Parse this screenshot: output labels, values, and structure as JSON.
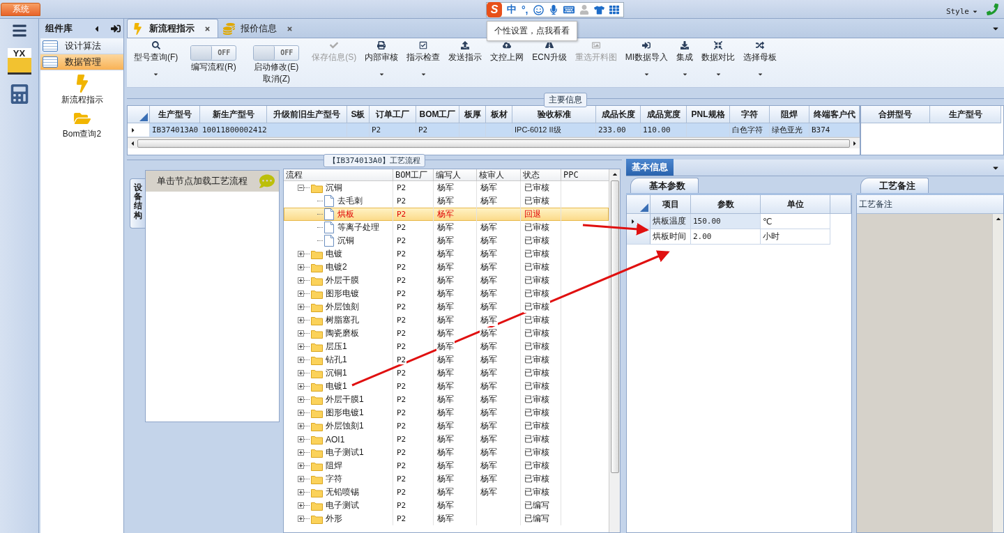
{
  "top_bar": {
    "system_button": "系统",
    "style_menu": "Style"
  },
  "ime_toolbar": {
    "logo": "S",
    "mode": "中",
    "punctuation": "°,",
    "tooltip": "个性设置，点我看看"
  },
  "rail": {
    "logo": "YX"
  },
  "component_panel": {
    "title": "组件库",
    "items": [
      {
        "label": "设计算法",
        "selected": false
      },
      {
        "label": "数据管理",
        "selected": true
      }
    ],
    "shortcuts": [
      "新流程指示",
      "Bom查询2"
    ]
  },
  "tabs": [
    {
      "label": "新流程指示",
      "selected": true
    },
    {
      "label": "报价信息",
      "selected": false
    }
  ],
  "toolbar": [
    {
      "kind": "button",
      "label": "型号查询(F)",
      "disabled": false,
      "dropdown": true
    },
    {
      "kind": "toggle",
      "switch": "OFF",
      "on": false,
      "label": "编写流程(R)"
    },
    {
      "kind": "toggle",
      "switch": "OFF",
      "on": false,
      "label": "启动修改(E)",
      "sublabel": "取消(Z)"
    },
    {
      "kind": "button",
      "label": "保存信息(S)",
      "disabled": true,
      "dropdown": false
    },
    {
      "kind": "button",
      "label": "内部审核",
      "disabled": false,
      "dropdown": true
    },
    {
      "kind": "button",
      "label": "指示检查",
      "disabled": false,
      "dropdown": true
    },
    {
      "kind": "button",
      "label": "发送指示",
      "disabled": false,
      "dropdown": false
    },
    {
      "kind": "button",
      "label": "文控上网",
      "disabled": false,
      "dropdown": false
    },
    {
      "kind": "button",
      "label": "ECN升级",
      "disabled": false,
      "dropdown": false
    },
    {
      "kind": "button",
      "label": "重选开料图",
      "disabled": true,
      "dropdown": false
    },
    {
      "kind": "button",
      "label": "MI数据导入",
      "disabled": false,
      "dropdown": true
    },
    {
      "kind": "button",
      "label": "集成",
      "disabled": false,
      "dropdown": true
    },
    {
      "kind": "button",
      "label": "数据对比",
      "disabled": false,
      "dropdown": true
    },
    {
      "kind": "button",
      "label": "选择母板",
      "disabled": false,
      "dropdown": true
    }
  ],
  "main_info": {
    "title": "主要信息",
    "columns": [
      "生产型号",
      "新生产型号",
      "升级前旧生产型号",
      "S板",
      "订单工厂",
      "BOM工厂",
      "板厚",
      "板材",
      "验收标准",
      "成品长度",
      "成品宽度",
      "PNL规格",
      "字符",
      "阻焊",
      "终端客户代"
    ],
    "rows": [
      {
        "selected": true,
        "cells": [
          "IB374013A0",
          "10011800002412",
          null,
          null,
          "P2",
          "P2",
          null,
          null,
          "IPC-6012 II级",
          "233.00",
          "110.00",
          null,
          "白色字符",
          "绿色亚光",
          "B374"
        ]
      }
    ],
    "merge_columns": [
      "合拼型号",
      "生产型号"
    ]
  },
  "process_panel": {
    "title": "【IB374013A0】工艺流程",
    "side_tab": "设备结构",
    "hint": "单击节点加载工艺流程",
    "columns": [
      "流程",
      "BOM工厂",
      "编写人",
      "核审人",
      "状态",
      "PPC"
    ],
    "tree": [
      {
        "name": "沉铜",
        "kind": "folder",
        "expanded": true,
        "selected": false,
        "bom_factory": "P2",
        "writer": "杨军",
        "reviewer": "杨军",
        "status": "已审核",
        "children": [
          {
            "name": "去毛刺",
            "kind": "file",
            "selected": false,
            "bom_factory": "P2",
            "writer": "杨军",
            "reviewer": "杨军",
            "status": "已审核"
          },
          {
            "name": "烘板",
            "kind": "file",
            "selected": true,
            "bom_factory": "P2",
            "writer": "杨军",
            "status": "回退"
          },
          {
            "name": "等离子处理",
            "kind": "file",
            "selected": false,
            "bom_factory": "P2",
            "writer": "杨军",
            "reviewer": "杨军",
            "status": "已审核"
          },
          {
            "name": "沉铜",
            "kind": "file",
            "selected": false,
            "bom_factory": "P2",
            "writer": "杨军",
            "reviewer": "杨军",
            "status": "已审核"
          }
        ]
      },
      {
        "name": "电镀",
        "kind": "folder",
        "expanded": false,
        "selected": false,
        "bom_factory": "P2",
        "writer": "杨军",
        "reviewer": "杨军",
        "status": "已审核"
      },
      {
        "name": "电镀2",
        "kind": "folder",
        "expanded": false,
        "selected": false,
        "bom_factory": "P2",
        "writer": "杨军",
        "reviewer": "杨军",
        "status": "已审核"
      },
      {
        "name": "外层干膜",
        "kind": "folder",
        "expanded": false,
        "selected": false,
        "bom_factory": "P2",
        "writer": "杨军",
        "reviewer": "杨军",
        "status": "已审核"
      },
      {
        "name": "图形电镀",
        "kind": "folder",
        "expanded": false,
        "selected": false,
        "bom_factory": "P2",
        "writer": "杨军",
        "reviewer": "杨军",
        "status": "已审核"
      },
      {
        "name": "外层蚀刻",
        "kind": "folder",
        "expanded": false,
        "selected": false,
        "bom_factory": "P2",
        "writer": "杨军",
        "reviewer": "杨军",
        "status": "已审核"
      },
      {
        "name": "树脂塞孔",
        "kind": "folder",
        "expanded": false,
        "selected": false,
        "bom_factory": "P2",
        "writer": "杨军",
        "reviewer": "杨军",
        "status": "已审核"
      },
      {
        "name": "陶瓷磨板",
        "kind": "folder",
        "expanded": false,
        "selected": false,
        "bom_factory": "P2",
        "writer": "杨军",
        "reviewer": "杨军",
        "status": "已审核"
      },
      {
        "name": "层压1",
        "kind": "folder",
        "expanded": false,
        "selected": false,
        "bom_factory": "P2",
        "writer": "杨军",
        "reviewer": "杨军",
        "status": "已审核"
      },
      {
        "name": "钻孔1",
        "kind": "folder",
        "expanded": false,
        "selected": false,
        "bom_factory": "P2",
        "writer": "杨军",
        "reviewer": "杨军",
        "status": "已审核"
      },
      {
        "name": "沉铜1",
        "kind": "folder",
        "expanded": false,
        "selected": false,
        "bom_factory": "P2",
        "writer": "杨军",
        "reviewer": "杨军",
        "status": "已审核"
      },
      {
        "name": "电镀1",
        "kind": "folder",
        "expanded": false,
        "selected": false,
        "bom_factory": "P2",
        "writer": "杨军",
        "reviewer": "杨军",
        "status": "已审核"
      },
      {
        "name": "外层干膜1",
        "kind": "folder",
        "expanded": false,
        "selected": false,
        "bom_factory": "P2",
        "writer": "杨军",
        "reviewer": "杨军",
        "status": "已审核"
      },
      {
        "name": "图形电镀1",
        "kind": "folder",
        "expanded": false,
        "selected": false,
        "bom_factory": "P2",
        "writer": "杨军",
        "reviewer": "杨军",
        "status": "已审核"
      },
      {
        "name": "外层蚀刻1",
        "kind": "folder",
        "expanded": false,
        "selected": false,
        "bom_factory": "P2",
        "writer": "杨军",
        "reviewer": "杨军",
        "status": "已审核"
      },
      {
        "name": "AOI1",
        "kind": "folder",
        "expanded": false,
        "selected": false,
        "bom_factory": "P2",
        "writer": "杨军",
        "reviewer": "杨军",
        "status": "已审核"
      },
      {
        "name": "电子测试1",
        "kind": "folder",
        "expanded": false,
        "selected": false,
        "bom_factory": "P2",
        "writer": "杨军",
        "reviewer": "杨军",
        "status": "已审核"
      },
      {
        "name": "阻焊",
        "kind": "folder",
        "expanded": false,
        "selected": false,
        "bom_factory": "P2",
        "writer": "杨军",
        "reviewer": "杨军",
        "status": "已审核"
      },
      {
        "name": "字符",
        "kind": "folder",
        "expanded": false,
        "selected": false,
        "bom_factory": "P2",
        "writer": "杨军",
        "reviewer": "杨军",
        "status": "已审核"
      },
      {
        "name": "无铅喷锡",
        "kind": "folder",
        "expanded": false,
        "selected": false,
        "bom_factory": "P2",
        "writer": "杨军",
        "reviewer": "杨军",
        "status": "已审核"
      },
      {
        "name": "电子测试",
        "kind": "folder",
        "expanded": false,
        "selected": false,
        "bom_factory": "P2",
        "writer": "杨军",
        "status": "已编写"
      },
      {
        "name": "外形",
        "kind": "folder",
        "expanded": false,
        "selected": false,
        "bom_factory": "P2",
        "writer": "杨军",
        "status": "已编写"
      }
    ]
  },
  "detail_panel": {
    "tab": "基本信息",
    "params": {
      "tab": "基本参数",
      "columns": [
        "项目",
        "参数",
        "单位"
      ],
      "rows": [
        {
          "item": "烘板温度",
          "value": "150.00",
          "unit": "℃",
          "current": true
        },
        {
          "item": "烘板时间",
          "value": "2.00",
          "unit": "小时",
          "current": false
        }
      ]
    },
    "notes": {
      "tab": "工艺备注",
      "column": "工艺备注"
    }
  }
}
